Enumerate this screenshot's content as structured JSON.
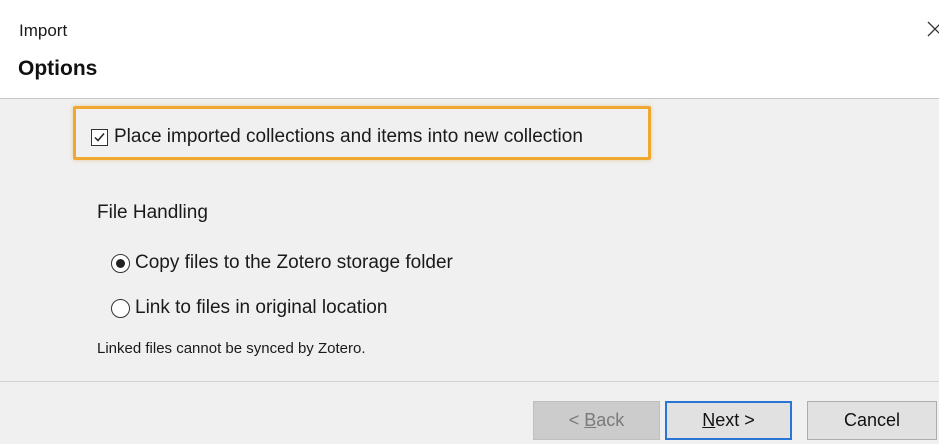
{
  "window": {
    "title": "Import",
    "heading": "Options"
  },
  "options": {
    "new_collection": {
      "label": "Place imported collections and items into new collection",
      "checked": true
    },
    "file_handling": {
      "label": "File Handling",
      "choices": [
        {
          "label": "Copy files to the Zotero storage folder",
          "selected": true
        },
        {
          "label": "Link to files in original location",
          "selected": false
        }
      ],
      "note": "Linked files cannot be synced by Zotero."
    }
  },
  "buttons": {
    "back": {
      "prefix": "< ",
      "mnemonic": "B",
      "rest": "ack",
      "enabled": false
    },
    "next": {
      "mnemonic": "N",
      "rest": "ext >",
      "enabled": true
    },
    "cancel": {
      "label": "Cancel",
      "enabled": true
    }
  },
  "colors": {
    "highlight": "#f0a830",
    "default_button_border": "#2a74d6",
    "panel_background": "#f0f0f0"
  }
}
